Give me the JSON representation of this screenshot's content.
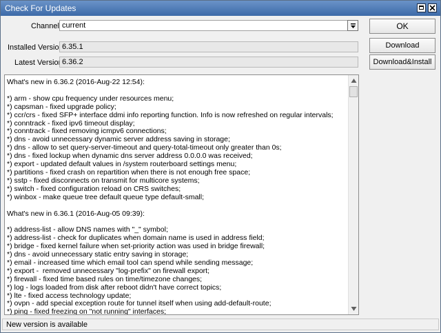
{
  "window": {
    "title": "Check For Updates"
  },
  "form": {
    "channel_label": "Channel:",
    "channel_value": "current",
    "installed_label": "Installed Version:",
    "installed_value": "6.35.1",
    "latest_label": "Latest Version:",
    "latest_value": "6.36.2"
  },
  "buttons": {
    "ok": "OK",
    "download": "Download",
    "download_install": "Download&Install"
  },
  "notes": {
    "text": "What's new in 6.36.2 (2016-Aug-22 12:54):\n\n*) arm - show cpu frequency under resources menu;\n*) capsman - fixed upgrade policy;\n*) ccr/crs - fixed SFP+ interface ddmi info reporting function. Info is now refreshed on regular intervals;\n*) conntrack - fixed ipv6 timeout display;\n*) conntrack - fixed removing icmpv6 connections;\n*) dns - avoid unnecessary dynamic server address saving in storage;\n*) dns - allow to set query-server-timeout and query-total-timeout only greater than 0s;\n*) dns - fixed lockup when dynamic dns server address 0.0.0.0 was received;\n*) export - updated default values in /system routerboard settings menu;\n*) partitions - fixed crash on repartition when there is not enough free space;\n*) sstp - fixed disconnects on transmit for multicore systems;\n*) switch - fixed configuration reload on CRS switches;\n*) winbox - make queue tree default queue type default-small;\n\nWhat's new in 6.36.1 (2016-Aug-05 09:39):\n\n*) address-list - allow DNS names with \"_\" symbol;\n*) address-list - check for duplicates when domain name is used in address field;\n*) bridge - fixed kernel failure when set-priority action was used in bridge firewall;\n*) dns - avoid unnecessary static entry saving in storage;\n*) email - increased time which email tool can spend while sending message;\n*) export -  removed unnecessary \"log-prefix\" on firewall export;\n*) firewall - fixed time based rules on time/timezone changes;\n*) log - logs loaded from disk after reboot didn't have correct topics;\n*) lte - fixed access technology update;\n*) ovpn - add special exception route for tunnel itself when using add-default-route;\n*) ping - fixed freezing on \"not running\" interfaces;\n*) resource - fixed free-memory reporting after disk eject;"
  },
  "status": {
    "text": "New version is available"
  }
}
